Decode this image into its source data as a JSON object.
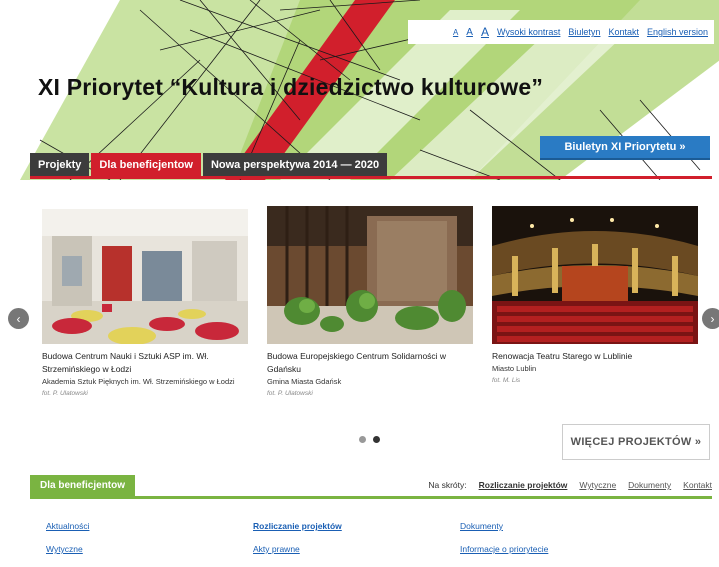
{
  "topbar": {
    "font_small": "A",
    "font_medium": "A",
    "font_large": "A",
    "high_contrast": "Wysoki kontrast",
    "bulletin": "Biuletyn",
    "contact": "Kontakt",
    "english": "English version"
  },
  "header": {
    "title": "XI Priorytet “Kultura i dziedzictwo kulturowe”",
    "biuletyn_button": "Biuletyn XI Priorytetu »"
  },
  "tabs": [
    {
      "label": "Projekty"
    },
    {
      "label": "Dla beneficjentow"
    },
    {
      "label": "Nowa perspektywa 2014 — 2020"
    }
  ],
  "slides": [
    {
      "caption": "Budowa Centrum Nauki i Sztuki ASP im. Wł. Strzemińskiego w Łodzi",
      "sub": "Akademia Sztuk Pięknych im. Wł. Strzemińskiego w Łodzi",
      "credit": "fot. P. Ulatowski"
    },
    {
      "caption": "Budowa Europejskiego Centrum Solidarności w Gdańsku",
      "sub": "Gmina Miasta Gdańsk",
      "credit": "fot. P. Ulatowski"
    },
    {
      "caption": "Renowacja Teatru Starego w Lublinie",
      "sub": "Miasto Lublin",
      "credit": "fot. M. Lis"
    }
  ],
  "carousel": {
    "prev_icon": "‹",
    "next_icon": "›",
    "more_button": "WIĘCEJ PROJEKTÓW »"
  },
  "beneficiaries": {
    "label": "Dla beneficjentow",
    "shortcuts_label": "Na skróty:",
    "shortcuts": [
      "Rozliczanie projektów",
      "Wytyczne",
      "Dokumenty",
      "Kontakt"
    ]
  },
  "links": {
    "col1": [
      "Aktualności",
      "Wytyczne"
    ],
    "col2": [
      "Rozliczanie projektów",
      "Akty prawne"
    ],
    "col3": [
      "Dokumenty",
      "Informacje o priorytecie"
    ]
  },
  "colors": {
    "accent_red": "#d11f2c",
    "accent_green": "#7ab441",
    "accent_blue": "#2a7bc4",
    "tab_dark": "#3c3c3c"
  }
}
